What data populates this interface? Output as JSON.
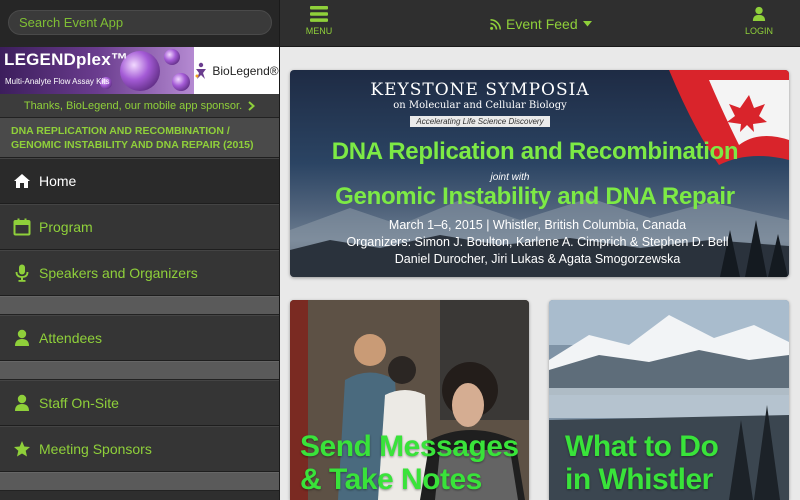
{
  "search": {
    "placeholder": "Search Event App"
  },
  "sponsor_banner": {
    "title": "LEGENDplex™",
    "subtitle": "Multi-Analyte Flow Assay Kits",
    "brand": "BioLegend®"
  },
  "sponsor_thanks": "Thanks, BioLegend, our mobile app sponsor.",
  "event_title": "DNA REPLICATION AND RECOMBINATION / GENOMIC INSTABILITY AND DNA REPAIR (2015)",
  "nav": {
    "home": "Home",
    "program": "Program",
    "speakers": "Speakers and Organizers",
    "attendees": "Attendees",
    "staff": "Staff On-Site",
    "sponsors": "Meeting Sponsors"
  },
  "topbar": {
    "menu_label": "MENU",
    "feed_label": "Event Feed",
    "login_label": "LOGIN"
  },
  "hero": {
    "org_title": "KEYSTONE SYMPOSIA",
    "org_subtitle": "on Molecular and Cellular Biology",
    "org_tagline": "Accelerating Life Science Discovery",
    "headline_1": "DNA Replication and Recombination",
    "joint": "joint with",
    "headline_2": "Genomic Instability and DNA Repair",
    "info_line_1": "March 1–6, 2015 | Whistler, British Columbia, Canada",
    "info_line_2": "Organizers: Simon J. Boulton, Karlene A. Cimprich & Stephen D. Bell",
    "info_line_3": "Daniel Durocher, Jiri Lukas & Agata Smogorzewska"
  },
  "tiles": {
    "messages_line_1": "Send Messages",
    "messages_line_2": "& Take Notes",
    "whistler_line_1": "What to Do",
    "whistler_line_2": "in Whistler"
  },
  "colors": {
    "accent_green": "#8fd03a",
    "sidebar_bg": "#2e2e2e",
    "topbar_bg": "#2f2f2f"
  }
}
